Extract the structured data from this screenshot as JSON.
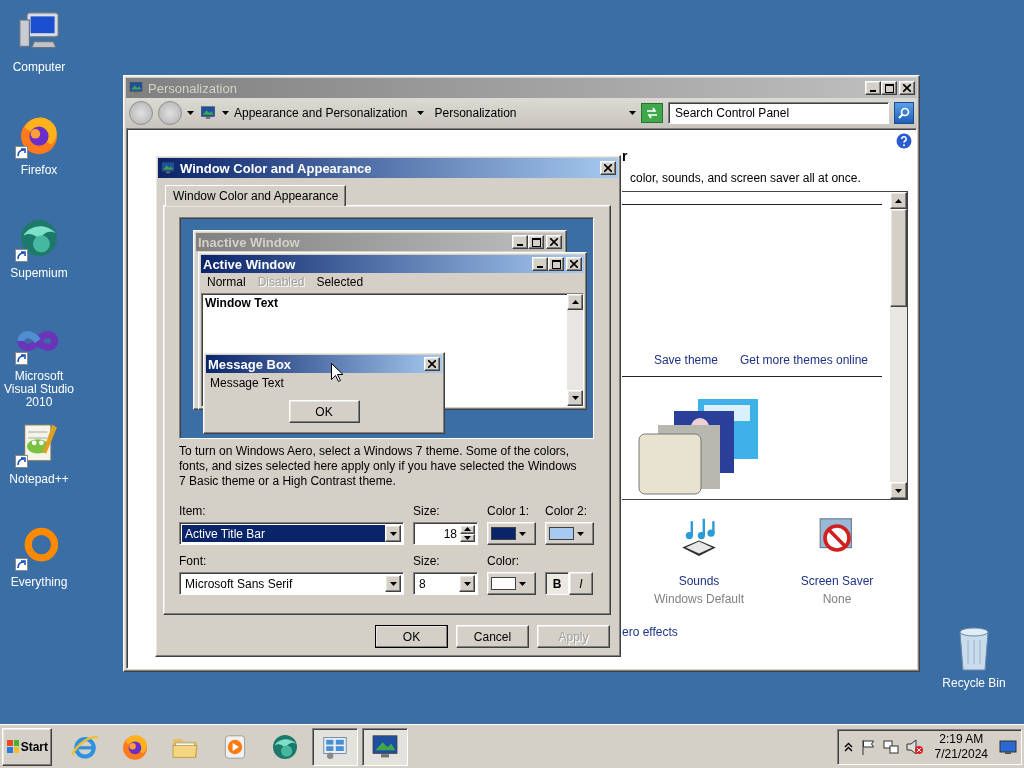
{
  "desktop_icons": [
    {
      "label": "Computer",
      "kind": "computer",
      "shortcut": false
    },
    {
      "label": "Firefox",
      "kind": "firefox",
      "shortcut": true
    },
    {
      "label": "Supemium",
      "kind": "supermium",
      "shortcut": true
    },
    {
      "label": "Microsoft Visual Studio 2010",
      "kind": "vs",
      "shortcut": true
    },
    {
      "label": "Notepad++",
      "kind": "notepad",
      "shortcut": true
    },
    {
      "label": "Everything",
      "kind": "everything",
      "shortcut": true
    }
  ],
  "recycle_bin": {
    "label": "Recycle Bin"
  },
  "personalization": {
    "title": "Personalization",
    "breadcrumb": [
      "Appearance and Personalization",
      "Personalization"
    ],
    "search": {
      "placeholder": "Search Control Panel"
    },
    "heading": "r",
    "description": "color, sounds, and screen saver all at once.",
    "theme_links": [
      "Save theme",
      "Get more themes online"
    ],
    "settings": [
      {
        "label": "Sounds",
        "value": "Windows Default",
        "kind": "sounds"
      },
      {
        "label": "Screen Saver",
        "value": "None",
        "kind": "screensaver"
      }
    ],
    "bottom_link": "ero effects"
  },
  "dialog": {
    "title": "Window Color and Appearance",
    "tabs": [
      {
        "label": "Window Color and Appearance",
        "selected": true
      }
    ],
    "preview": {
      "inactive_title": "Inactive Window",
      "active_title": "Active Window",
      "menu": [
        {
          "label": "Normal",
          "disabled": false
        },
        {
          "label": "Disabled",
          "disabled": true
        },
        {
          "label": "Selected",
          "disabled": false
        }
      ],
      "window_text": "Window Text",
      "message_title": "Message Box",
      "message_text": "Message Text",
      "message_button": "OK"
    },
    "note": "To turn on Windows Aero, select a Windows 7 theme.  Some of the colors, fonts, and sizes selected here apply only if you have selected the Windows 7 Basic theme or a High Contrast theme.",
    "item": {
      "label": "Item:",
      "value": "Active Title Bar"
    },
    "item_size": {
      "label": "Size:",
      "value": "18"
    },
    "color1": {
      "label": "Color 1:",
      "color": "#0a246a"
    },
    "color2": {
      "label": "Color 2:",
      "color": "#a6caf0"
    },
    "font": {
      "label": "Font:",
      "value": "Microsoft Sans Serif"
    },
    "font_size": {
      "label": "Size:",
      "value": "8"
    },
    "font_color": {
      "label": "Color:",
      "color": "#ffffff"
    },
    "bold": {
      "label": "B",
      "on": true
    },
    "italic": {
      "label": "I",
      "on": false
    },
    "buttons": [
      {
        "label": "OK",
        "disabled": false,
        "default": true
      },
      {
        "label": "Cancel",
        "disabled": false,
        "default": false
      },
      {
        "label": "Apply",
        "disabled": true,
        "default": false
      }
    ]
  },
  "taskbar": {
    "start": "Start",
    "apps": [
      {
        "kind": "ie",
        "active": false
      },
      {
        "kind": "firefox",
        "active": false
      },
      {
        "kind": "explorer",
        "active": false
      },
      {
        "kind": "media",
        "active": false
      },
      {
        "kind": "supermium",
        "active": false
      },
      {
        "kind": "controlpanel",
        "active": true
      },
      {
        "kind": "personalization",
        "active": true
      }
    ],
    "time": "2:19 AM",
    "date": "7/21/2024"
  }
}
